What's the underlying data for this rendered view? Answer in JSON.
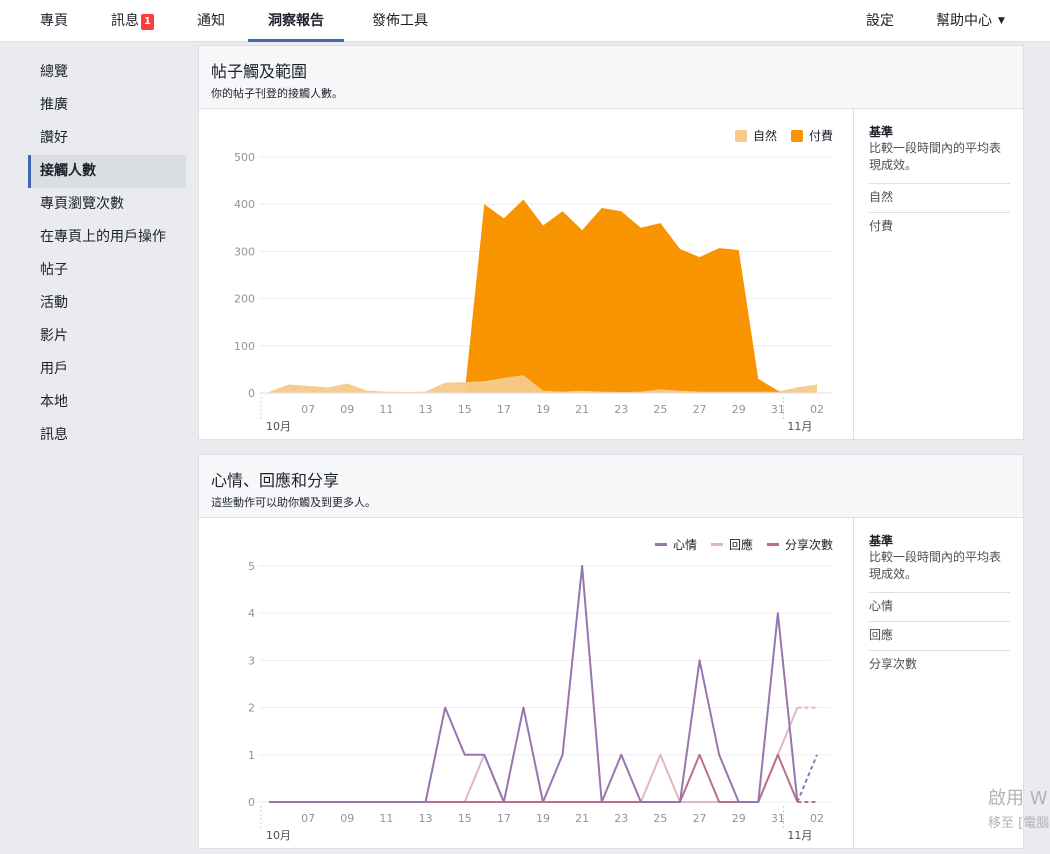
{
  "topnav": {
    "tabs": [
      {
        "label": "專頁",
        "left": 40
      },
      {
        "label": "訊息",
        "left": 111
      },
      {
        "label": "通知",
        "left": 197
      },
      {
        "label": "洞察報告",
        "left": 268
      },
      {
        "label": "發佈工具",
        "left": 372
      }
    ],
    "messages_badge": "1",
    "settings": "設定",
    "help": "幫助中心"
  },
  "leftnav": {
    "items": [
      "總覽",
      "推廣",
      "讚好",
      "接觸人數",
      "專頁瀏覽次數",
      "在專頁上的用戶操作",
      "帖子",
      "活動",
      "影片",
      "用戶",
      "本地",
      "訊息"
    ],
    "active_index": 3
  },
  "reach_card": {
    "title": "帖子觸及範圍",
    "subtitle": "你的帖子刊登的接觸人數。",
    "legend": [
      {
        "label": "自然",
        "color": "#f7c98b"
      },
      {
        "label": "付費",
        "color": "#f79400"
      }
    ],
    "side": {
      "heading": "基準",
      "desc": "比較一段時間內的平均表現成效。",
      "rows": [
        "自然",
        "付費"
      ]
    }
  },
  "reactions_card": {
    "title": "心情、回應和分享",
    "subtitle": "這些動作可以助你觸及到更多人。",
    "legend": [
      {
        "label": "心情",
        "color": "#9775b0"
      },
      {
        "label": "回應",
        "color": "#e2b4cb"
      },
      {
        "label": "分享次數",
        "color": "#bb6e8e"
      }
    ],
    "side": {
      "heading": "基準",
      "desc": "比較一段時間內的平均表現成效。",
      "rows": [
        "心情",
        "回應",
        "分享次數"
      ]
    }
  },
  "watermark": {
    "line1": "啟用 W",
    "line2": "移至 [電腦"
  },
  "chart_data": [
    {
      "type": "area",
      "x": [
        "10/05",
        "10/06",
        "10/07",
        "10/08",
        "10/09",
        "10/10",
        "10/11",
        "10/12",
        "10/13",
        "10/14",
        "10/15",
        "10/16",
        "10/17",
        "10/18",
        "10/19",
        "10/20",
        "10/21",
        "10/22",
        "10/23",
        "10/24",
        "10/25",
        "10/26",
        "10/27",
        "10/28",
        "10/29",
        "10/30",
        "10/31",
        "11/01",
        "11/02"
      ],
      "x_tick_labels": [
        "07",
        "09",
        "11",
        "13",
        "15",
        "17",
        "19",
        "21",
        "23",
        "25",
        "27",
        "29",
        "31",
        "02"
      ],
      "month_labels": [
        "10月",
        "11月"
      ],
      "ylim": [
        0,
        500
      ],
      "y_ticks": [
        0,
        100,
        200,
        300,
        400,
        500
      ],
      "grid": true,
      "legend_position": "top-right",
      "series": [
        {
          "name": "自然",
          "values": [
            2,
            18,
            15,
            12,
            20,
            5,
            3,
            2,
            3,
            22,
            23,
            25,
            32,
            38,
            5,
            3,
            5,
            3,
            2,
            3,
            8,
            5,
            3,
            3,
            3,
            3,
            3,
            12,
            18
          ]
        },
        {
          "name": "付費",
          "values": [
            0,
            0,
            0,
            0,
            0,
            0,
            0,
            0,
            0,
            0,
            0,
            400,
            370,
            410,
            355,
            385,
            345,
            392,
            385,
            350,
            360,
            305,
            288,
            307,
            303,
            30,
            5,
            0,
            0
          ]
        }
      ]
    },
    {
      "type": "line",
      "x": [
        "10/05",
        "10/06",
        "10/07",
        "10/08",
        "10/09",
        "10/10",
        "10/11",
        "10/12",
        "10/13",
        "10/14",
        "10/15",
        "10/16",
        "10/17",
        "10/18",
        "10/19",
        "10/20",
        "10/21",
        "10/22",
        "10/23",
        "10/24",
        "10/25",
        "10/26",
        "10/27",
        "10/28",
        "10/29",
        "10/30",
        "10/31",
        "11/01",
        "11/02"
      ],
      "x_tick_labels": [
        "07",
        "09",
        "11",
        "13",
        "15",
        "17",
        "19",
        "21",
        "23",
        "25",
        "27",
        "29",
        "31",
        "02"
      ],
      "month_labels": [
        "10月",
        "11月"
      ],
      "ylim": [
        0,
        5
      ],
      "y_ticks": [
        0,
        1,
        2,
        3,
        4,
        5
      ],
      "grid": true,
      "legend_position": "top-right",
      "series": [
        {
          "name": "心情",
          "values": [
            0,
            0,
            0,
            0,
            0,
            0,
            0,
            0,
            0,
            2,
            1,
            1,
            0,
            2,
            0,
            1,
            5,
            0,
            1,
            0,
            0,
            0,
            3,
            1,
            0,
            0,
            4,
            0,
            1
          ]
        },
        {
          "name": "回應",
          "values": [
            0,
            0,
            0,
            0,
            0,
            0,
            0,
            0,
            0,
            0,
            0,
            1,
            0,
            0,
            0,
            0,
            0,
            0,
            0,
            0,
            1,
            0,
            0,
            0,
            0,
            0,
            1,
            2,
            2
          ]
        },
        {
          "name": "分享次數",
          "values": [
            0,
            0,
            0,
            0,
            0,
            0,
            0,
            0,
            0,
            0,
            0,
            0,
            0,
            0,
            0,
            0,
            0,
            0,
            0,
            0,
            0,
            0,
            1,
            0,
            0,
            0,
            1,
            0,
            0
          ]
        }
      ]
    }
  ]
}
